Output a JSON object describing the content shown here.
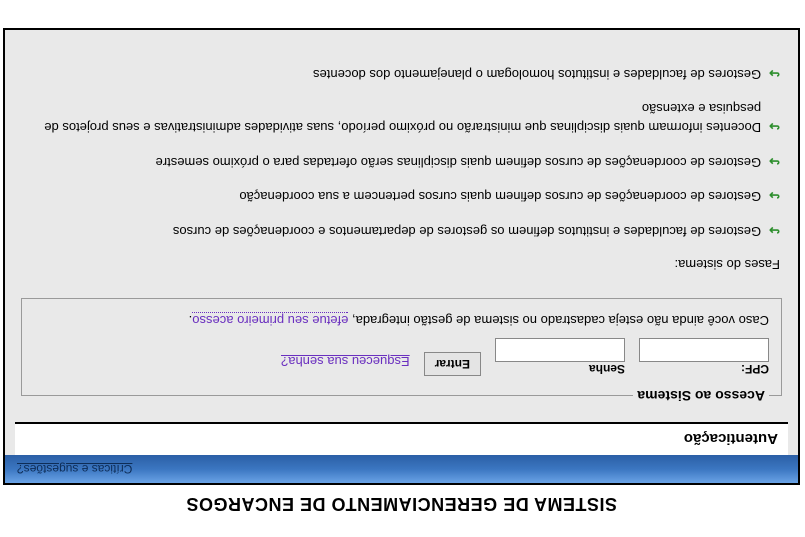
{
  "header": {
    "main_title": "SISTEMA DE GERENCIAMENTO DE ENCARGOS",
    "suggestions_link": "Críticas e sugestões?",
    "subheader": "Autenticação"
  },
  "auth": {
    "legend": "Acesso ao Sistema",
    "cpf_label": "CPF:",
    "cpf_value": "",
    "senha_label": "Senha",
    "senha_value": "",
    "entrar_label": "Entrar",
    "forgot_link": "Esqueceu sua senha?",
    "register_prefix": "Caso você ainda não esteja cadastrado no sistema de gestão integrada, ",
    "register_link": "efetue seu primeiro acesso",
    "register_suffix": "."
  },
  "phases": {
    "title": "Fases do sistema:",
    "items": [
      "Gestores de faculdades e institutos definem os gestores de departamentos e coordenações de cursos",
      "Gestores de coordenações de cursos definem quais cursos pertencem a sua coordenação",
      "Gestores de coordenações de cursos definem quais disciplinas serão ofertadas para o próximo semestre",
      "Docentes informam quais disciplinas que ministrarão no próximo período, suas atividades administrativas e seus projetos de pesquisa e extensão",
      "Gestores de faculdades e institutos homologam o planejamento dos docentes"
    ]
  }
}
